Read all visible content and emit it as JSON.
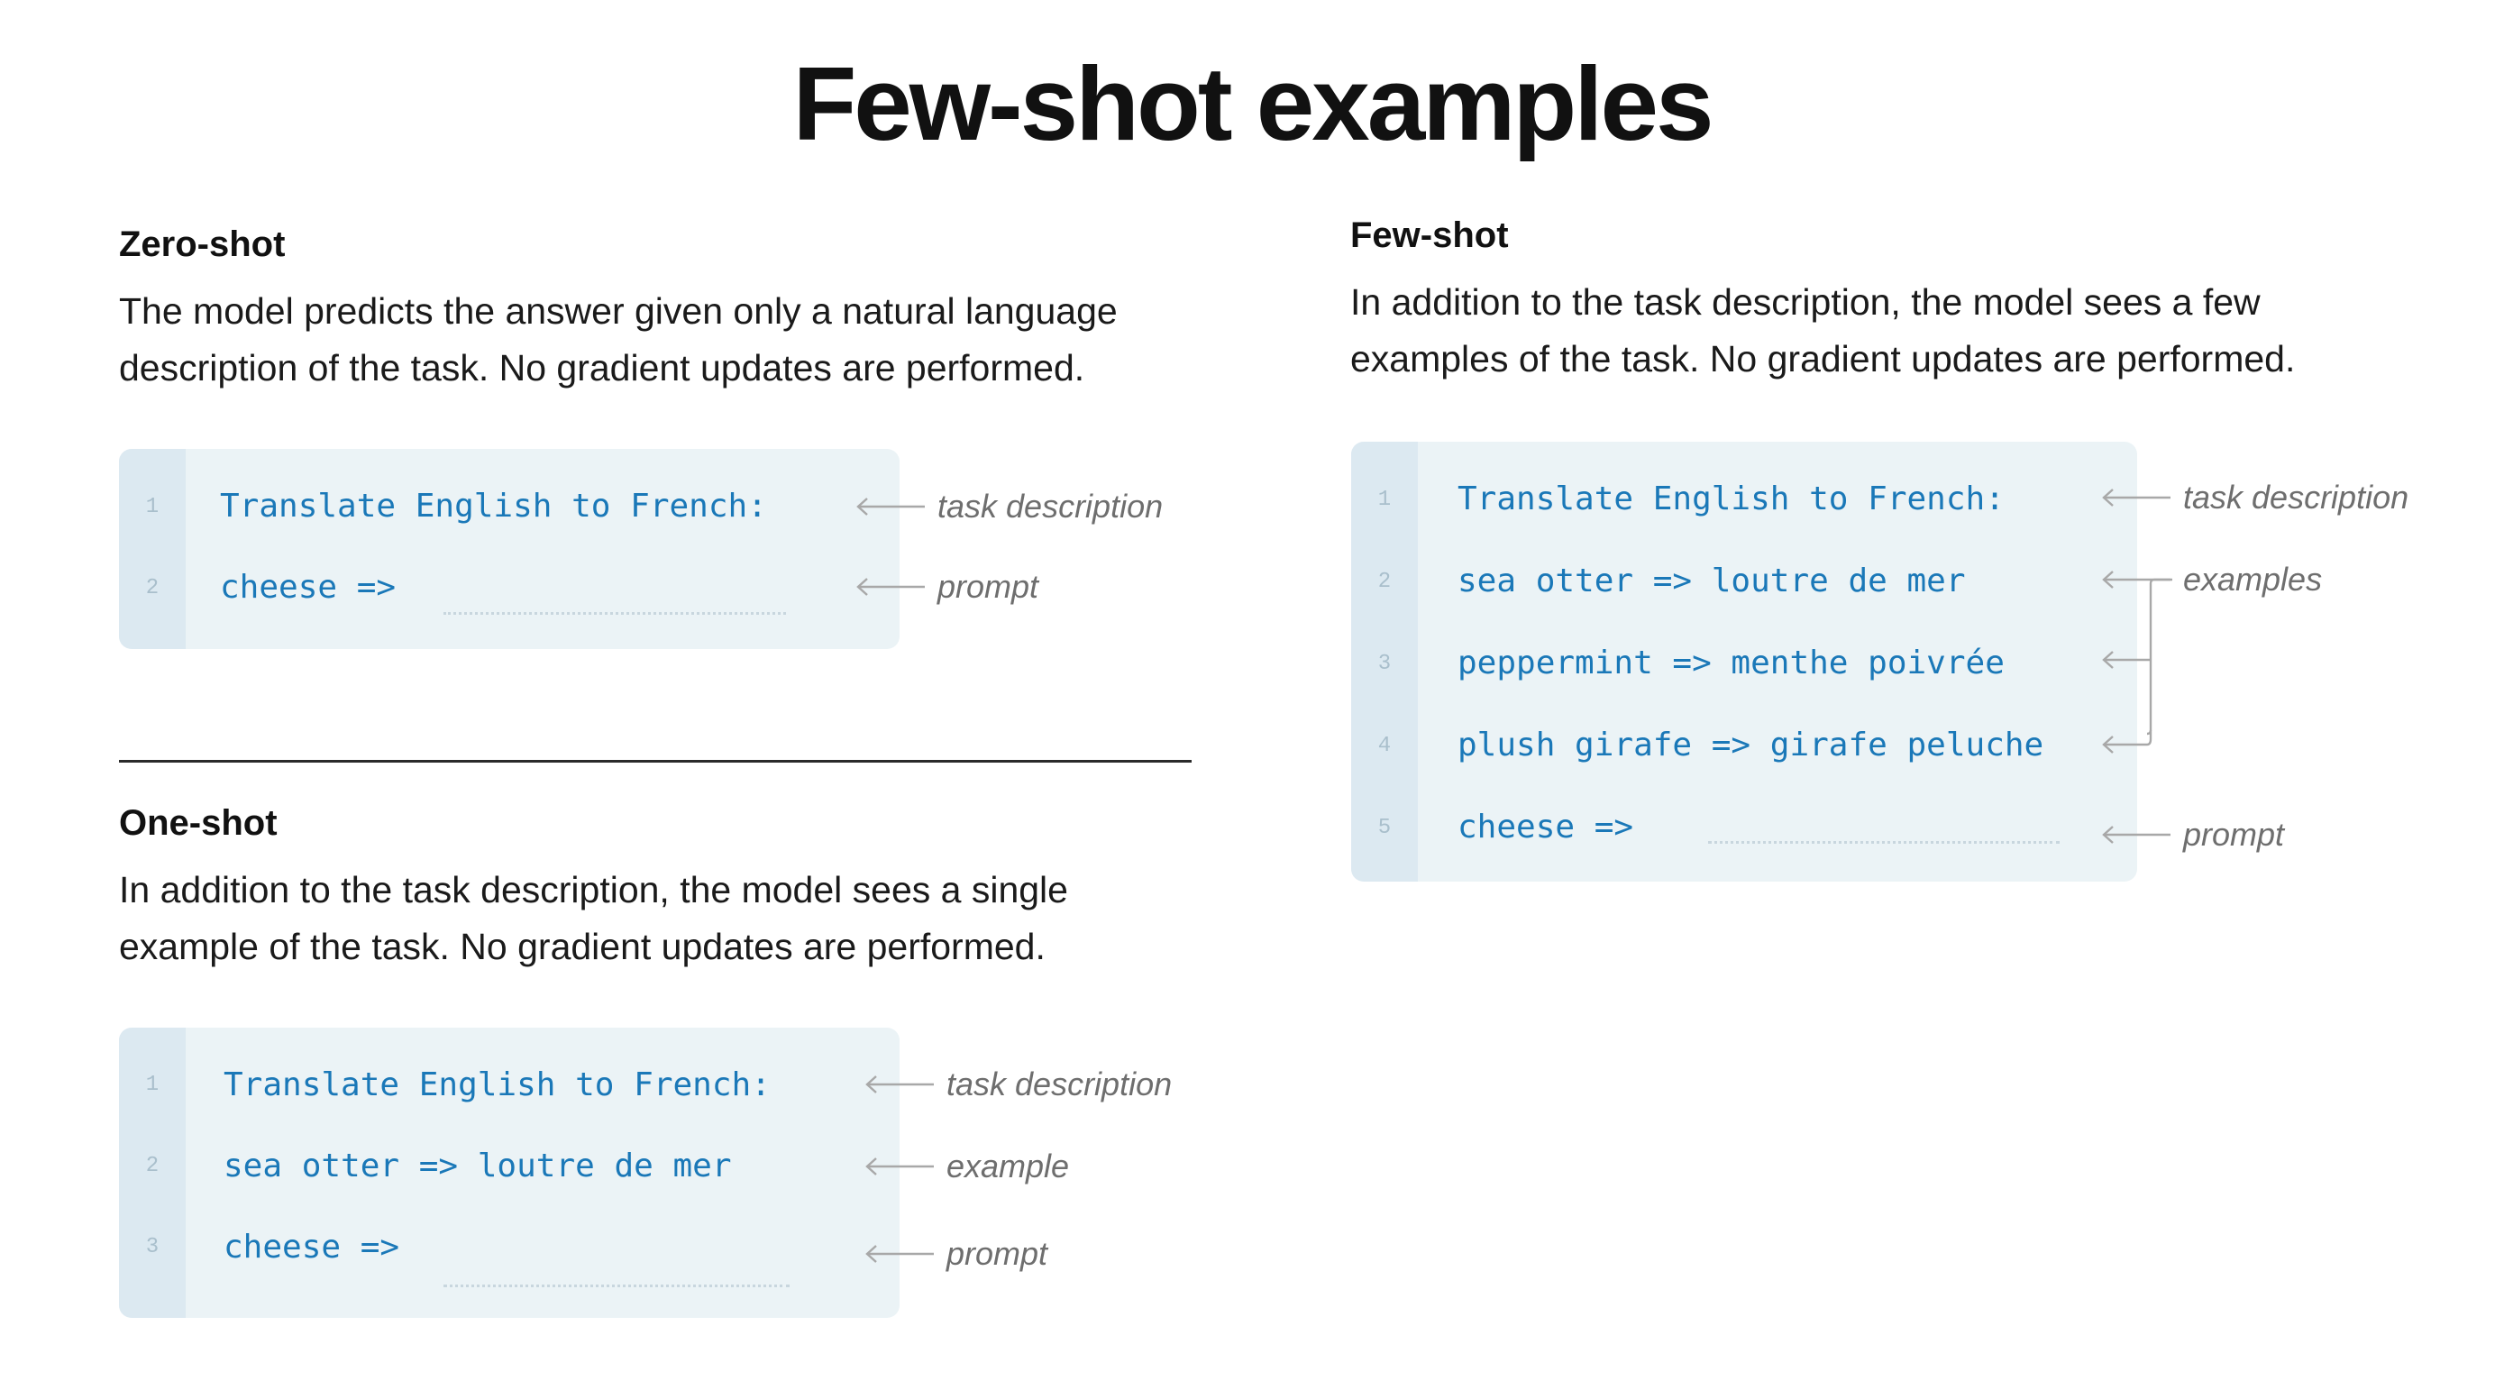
{
  "title": "Few-shot examples",
  "zero_shot": {
    "heading": "Zero-shot",
    "description": [
      "The model predicts the answer given only a natural language",
      "description of the task. No gradient updates are performed."
    ],
    "lines": [
      {
        "num": "1",
        "code": "Translate English to French:"
      },
      {
        "num": "2",
        "code": "cheese =>"
      }
    ],
    "annotations": [
      "task description",
      "prompt"
    ]
  },
  "one_shot": {
    "heading": "One-shot",
    "description": [
      "In addition to the task description, the model sees a single",
      "example of the task. No gradient updates are performed."
    ],
    "lines": [
      {
        "num": "1",
        "code": "Translate English to French:"
      },
      {
        "num": "2",
        "code": "sea otter => loutre de mer"
      },
      {
        "num": "3",
        "code": "cheese =>"
      }
    ],
    "annotations": [
      "task description",
      "example",
      "prompt"
    ]
  },
  "few_shot": {
    "heading": "Few-shot",
    "description": [
      "In addition to the task description, the model sees a few",
      "examples of the task. No gradient updates are performed."
    ],
    "lines": [
      {
        "num": "1",
        "code": "Translate English to French:"
      },
      {
        "num": "2",
        "code": "sea otter => loutre de mer"
      },
      {
        "num": "3",
        "code": "peppermint => menthe poivrée"
      },
      {
        "num": "4",
        "code": "plush girafe => girafe peluche"
      },
      {
        "num": "5",
        "code": "cheese =>"
      }
    ],
    "annotations": [
      "task description",
      "examples",
      "prompt"
    ]
  },
  "colors": {
    "code_text": "#1a78b8",
    "code_bg": "#ebf3f6",
    "gutter_bg": "#dce9f1",
    "annotation_text": "#6e6e6e"
  },
  "icons": {
    "annotation_pointer": "left-arrow-icon"
  }
}
